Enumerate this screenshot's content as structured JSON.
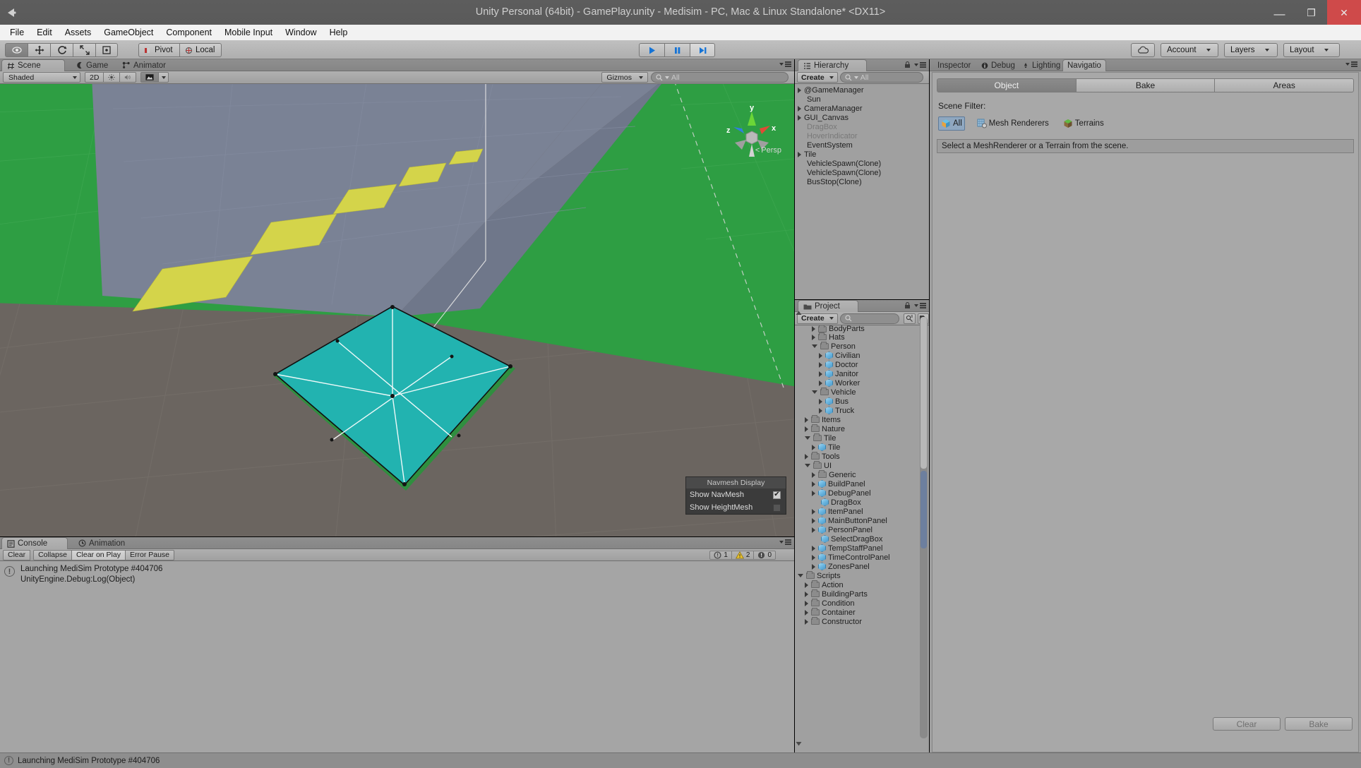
{
  "window": {
    "title": "Unity Personal (64bit) - GamePlay.unity - Medisim - PC, Mac & Linux Standalone* <DX11>",
    "minimize": "—",
    "maximize": "❐",
    "close": "✕"
  },
  "menubar": {
    "items": [
      "File",
      "Edit",
      "Assets",
      "GameObject",
      "Component",
      "Mobile Input",
      "Window",
      "Help"
    ]
  },
  "toolbar": {
    "tools": [
      {
        "name": "hand-tool",
        "glyph": "✋"
      },
      {
        "name": "move-tool",
        "glyph": "✥"
      },
      {
        "name": "rotate-tool",
        "glyph": "⟳"
      },
      {
        "name": "scale-tool",
        "glyph": "⤢"
      },
      {
        "name": "rect-tool",
        "glyph": "▣"
      }
    ],
    "pivot_label": "Pivot",
    "local_label": "Local",
    "play_label": "▶",
    "pause_label": "❚❚",
    "step_label": "▶❙",
    "cloud_label": "☁",
    "account_label": "Account",
    "layers_label": "Layers",
    "layout_label": "Layout"
  },
  "scene": {
    "tabs": [
      {
        "label": "Scene",
        "icon": "grid-icon",
        "selected": true
      },
      {
        "label": "Game",
        "icon": "gamepad-icon",
        "selected": false
      },
      {
        "label": "Animator",
        "icon": "animator-icon",
        "selected": false
      }
    ],
    "draw_mode": "Shaded",
    "mode_2d": "2D",
    "lighting_icon": "sun-icon",
    "audio_icon": "speaker-icon",
    "effects_icon": "image-icon",
    "gizmos_label": "Gizmos",
    "search_placeholder": "All",
    "gizmo_axes": {
      "x": "x",
      "y": "y",
      "z": "z"
    },
    "projection_label": "Persp",
    "colors": {
      "grass": "#2e9e43",
      "grass_dark": "#2b8c3d",
      "road": "#7a8295",
      "lane_marking": "#d4d44a",
      "navmesh": "#22b3b0",
      "ground": "#6b6560"
    }
  },
  "navmesh_popup": {
    "title": "Navmesh Display",
    "options": [
      {
        "label": "Show NavMesh",
        "checked": true
      },
      {
        "label": "Show HeightMesh",
        "checked": false
      }
    ],
    "tick": "✔"
  },
  "hierarchy": {
    "tab_label": "Hierarchy",
    "create_label": "Create",
    "search_placeholder": "All",
    "items": [
      {
        "label": "@GameManager",
        "expandable": true,
        "dim": false,
        "indent": 0
      },
      {
        "label": "Sun",
        "expandable": false,
        "dim": false,
        "indent": 0
      },
      {
        "label": "CameraManager",
        "expandable": true,
        "dim": false,
        "indent": 0
      },
      {
        "label": "GUI_Canvas",
        "expandable": true,
        "dim": false,
        "indent": 0
      },
      {
        "label": "DragBox",
        "expandable": false,
        "dim": true,
        "indent": 0
      },
      {
        "label": "HoverIndicator",
        "expandable": false,
        "dim": true,
        "indent": 0
      },
      {
        "label": "EventSystem",
        "expandable": false,
        "dim": false,
        "indent": 0
      },
      {
        "label": "Tile",
        "expandable": true,
        "dim": false,
        "indent": 0
      },
      {
        "label": "VehicleSpawn(Clone)",
        "expandable": false,
        "dim": false,
        "indent": 0
      },
      {
        "label": "VehicleSpawn(Clone)",
        "expandable": false,
        "dim": false,
        "indent": 0
      },
      {
        "label": "BusStop(Clone)",
        "expandable": false,
        "dim": false,
        "indent": 0
      }
    ]
  },
  "project": {
    "tab_label": "Project",
    "create_label": "Create",
    "search_placeholder": "",
    "items": [
      {
        "label": "BodyParts",
        "type": "folder",
        "indent": 2,
        "state": "collapsed",
        "clipped": true
      },
      {
        "label": "Hats",
        "type": "folder",
        "indent": 2,
        "state": "collapsed"
      },
      {
        "label": "Person",
        "type": "folder",
        "indent": 2,
        "state": "expanded"
      },
      {
        "label": "Civilian",
        "type": "prefab",
        "indent": 3,
        "state": "collapsed"
      },
      {
        "label": "Doctor",
        "type": "prefab",
        "indent": 3,
        "state": "collapsed"
      },
      {
        "label": "Janitor",
        "type": "prefab",
        "indent": 3,
        "state": "collapsed"
      },
      {
        "label": "Worker",
        "type": "prefab",
        "indent": 3,
        "state": "collapsed"
      },
      {
        "label": "Vehicle",
        "type": "folder",
        "indent": 2,
        "state": "expanded"
      },
      {
        "label": "Bus",
        "type": "prefab",
        "indent": 3,
        "state": "collapsed"
      },
      {
        "label": "Truck",
        "type": "prefab",
        "indent": 3,
        "state": "collapsed"
      },
      {
        "label": "Items",
        "type": "folder",
        "indent": 1,
        "state": "collapsed"
      },
      {
        "label": "Nature",
        "type": "folder",
        "indent": 1,
        "state": "collapsed"
      },
      {
        "label": "Tile",
        "type": "folder",
        "indent": 1,
        "state": "expanded"
      },
      {
        "label": "Tile",
        "type": "prefab",
        "indent": 2,
        "state": "collapsed"
      },
      {
        "label": "Tools",
        "type": "folder",
        "indent": 1,
        "state": "collapsed"
      },
      {
        "label": "UI",
        "type": "folder",
        "indent": 1,
        "state": "expanded"
      },
      {
        "label": "Generic",
        "type": "folder",
        "indent": 2,
        "state": "collapsed"
      },
      {
        "label": "BuildPanel",
        "type": "prefab",
        "indent": 2,
        "state": "collapsed"
      },
      {
        "label": "DebugPanel",
        "type": "prefab",
        "indent": 2,
        "state": "collapsed"
      },
      {
        "label": "DragBox",
        "type": "prefab",
        "indent": 2,
        "state": "leaf"
      },
      {
        "label": "ItemPanel",
        "type": "prefab",
        "indent": 2,
        "state": "collapsed"
      },
      {
        "label": "MainButtonPanel",
        "type": "prefab",
        "indent": 2,
        "state": "collapsed"
      },
      {
        "label": "PersonPanel",
        "type": "prefab",
        "indent": 2,
        "state": "collapsed"
      },
      {
        "label": "SelectDragBox",
        "type": "prefab",
        "indent": 2,
        "state": "leaf"
      },
      {
        "label": "TempStaffPanel",
        "type": "prefab",
        "indent": 2,
        "state": "collapsed"
      },
      {
        "label": "TimeControlPanel",
        "type": "prefab",
        "indent": 2,
        "state": "collapsed"
      },
      {
        "label": "ZonesPanel",
        "type": "prefab",
        "indent": 2,
        "state": "collapsed"
      },
      {
        "label": "Scripts",
        "type": "folder",
        "indent": 0,
        "state": "expanded"
      },
      {
        "label": "Action",
        "type": "folder",
        "indent": 1,
        "state": "collapsed"
      },
      {
        "label": "BuildingParts",
        "type": "folder",
        "indent": 1,
        "state": "collapsed"
      },
      {
        "label": "Condition",
        "type": "folder",
        "indent": 1,
        "state": "collapsed"
      },
      {
        "label": "Container",
        "type": "folder",
        "indent": 1,
        "state": "collapsed"
      },
      {
        "label": "Constructor",
        "type": "folder",
        "indent": 1,
        "state": "collapsed",
        "clipped": true
      }
    ]
  },
  "inspector": {
    "tabs": [
      {
        "label": "Inspector",
        "selected": false
      },
      {
        "label": "Debug",
        "selected": false,
        "icon": "info-icon"
      },
      {
        "label": "Lighting",
        "selected": false,
        "icon": "lighting-icon"
      },
      {
        "label": "Navigatio",
        "selected": true
      }
    ],
    "nav_segments": [
      {
        "label": "Object",
        "active": true
      },
      {
        "label": "Bake",
        "active": false
      },
      {
        "label": "Areas",
        "active": false
      }
    ],
    "scene_filter_label": "Scene Filter:",
    "filters": [
      {
        "label": "All",
        "icon": "cube-icon",
        "selected": true
      },
      {
        "label": "Mesh Renderers",
        "icon": "mesh-icon",
        "selected": false
      },
      {
        "label": "Terrains",
        "icon": "terrain-icon",
        "selected": false
      }
    ],
    "help_text": "Select a MeshRenderer or a Terrain from the scene.",
    "clear_label": "Clear",
    "bake_label": "Bake"
  },
  "console": {
    "tabs": [
      {
        "label": "Console",
        "selected": true,
        "icon": "console-icon"
      },
      {
        "label": "Animation",
        "selected": false,
        "icon": "clock-icon"
      }
    ],
    "buttons": [
      {
        "label": "Clear",
        "toggled": false
      },
      {
        "label": "Collapse",
        "toggled": false
      },
      {
        "label": "Clear on Play",
        "toggled": true
      },
      {
        "label": "Error Pause",
        "toggled": false
      }
    ],
    "counts": [
      {
        "icon": "info-icon",
        "value": "1"
      },
      {
        "icon": "warning-icon",
        "value": "2"
      },
      {
        "icon": "error-icon",
        "value": "0"
      }
    ],
    "entries": [
      {
        "line1": "Launching MediSim Prototype #404706",
        "line2": "UnityEngine.Debug:Log(Object)",
        "icon": "info-icon"
      }
    ]
  },
  "statusbar": {
    "text": "Launching MediSim Prototype #404706",
    "icon": "info-icon"
  }
}
